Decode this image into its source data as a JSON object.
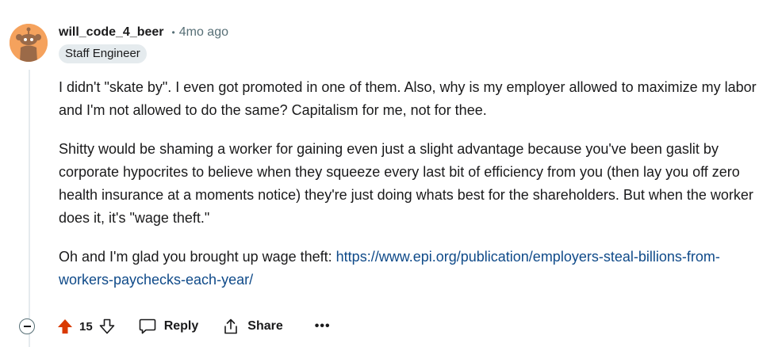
{
  "comment": {
    "author": "will_code_4_beer",
    "separator": "•",
    "age": "4mo ago",
    "flair": "Staff Engineer",
    "paragraph1": "I didn't \"skate by\". I even got promoted in one of them. Also, why is my employer allowed to maximize my labor and I'm not allowed to do the same? Capitalism for me, not for thee.",
    "paragraph2": "Shitty would be shaming a worker for gaining even just a slight advantage because you've been gaslit by corporate hypocrites to believe when they squeeze every last bit of efficiency from you (then lay you off zero health insurance at a moments notice) they're just doing whats best for the shareholders. But when the worker does it, it's \"wage theft.\"",
    "paragraph3_prefix": "Oh and I'm glad you brought up wage theft: ",
    "link_text": "https://www.epi.org/publication/employers-steal-billions-from-workers-paychecks-each-year/"
  },
  "actions": {
    "vote_count": "15",
    "reply_label": "Reply",
    "share_label": "Share",
    "more_label": "•••"
  },
  "colors": {
    "upvote_active": "#d93900",
    "avatar_bg": "#f5a25d",
    "link": "#0f4a89",
    "meta_text": "#576f76",
    "flair_bg": "#e5ebee"
  },
  "icons": {
    "avatar": "snoo-avatar-icon",
    "collapse": "collapse-minus-icon",
    "upvote": "upvote-arrow-icon",
    "downvote": "downvote-arrow-icon",
    "reply": "comment-bubble-icon",
    "share": "share-icon",
    "more": "more-options-icon"
  }
}
